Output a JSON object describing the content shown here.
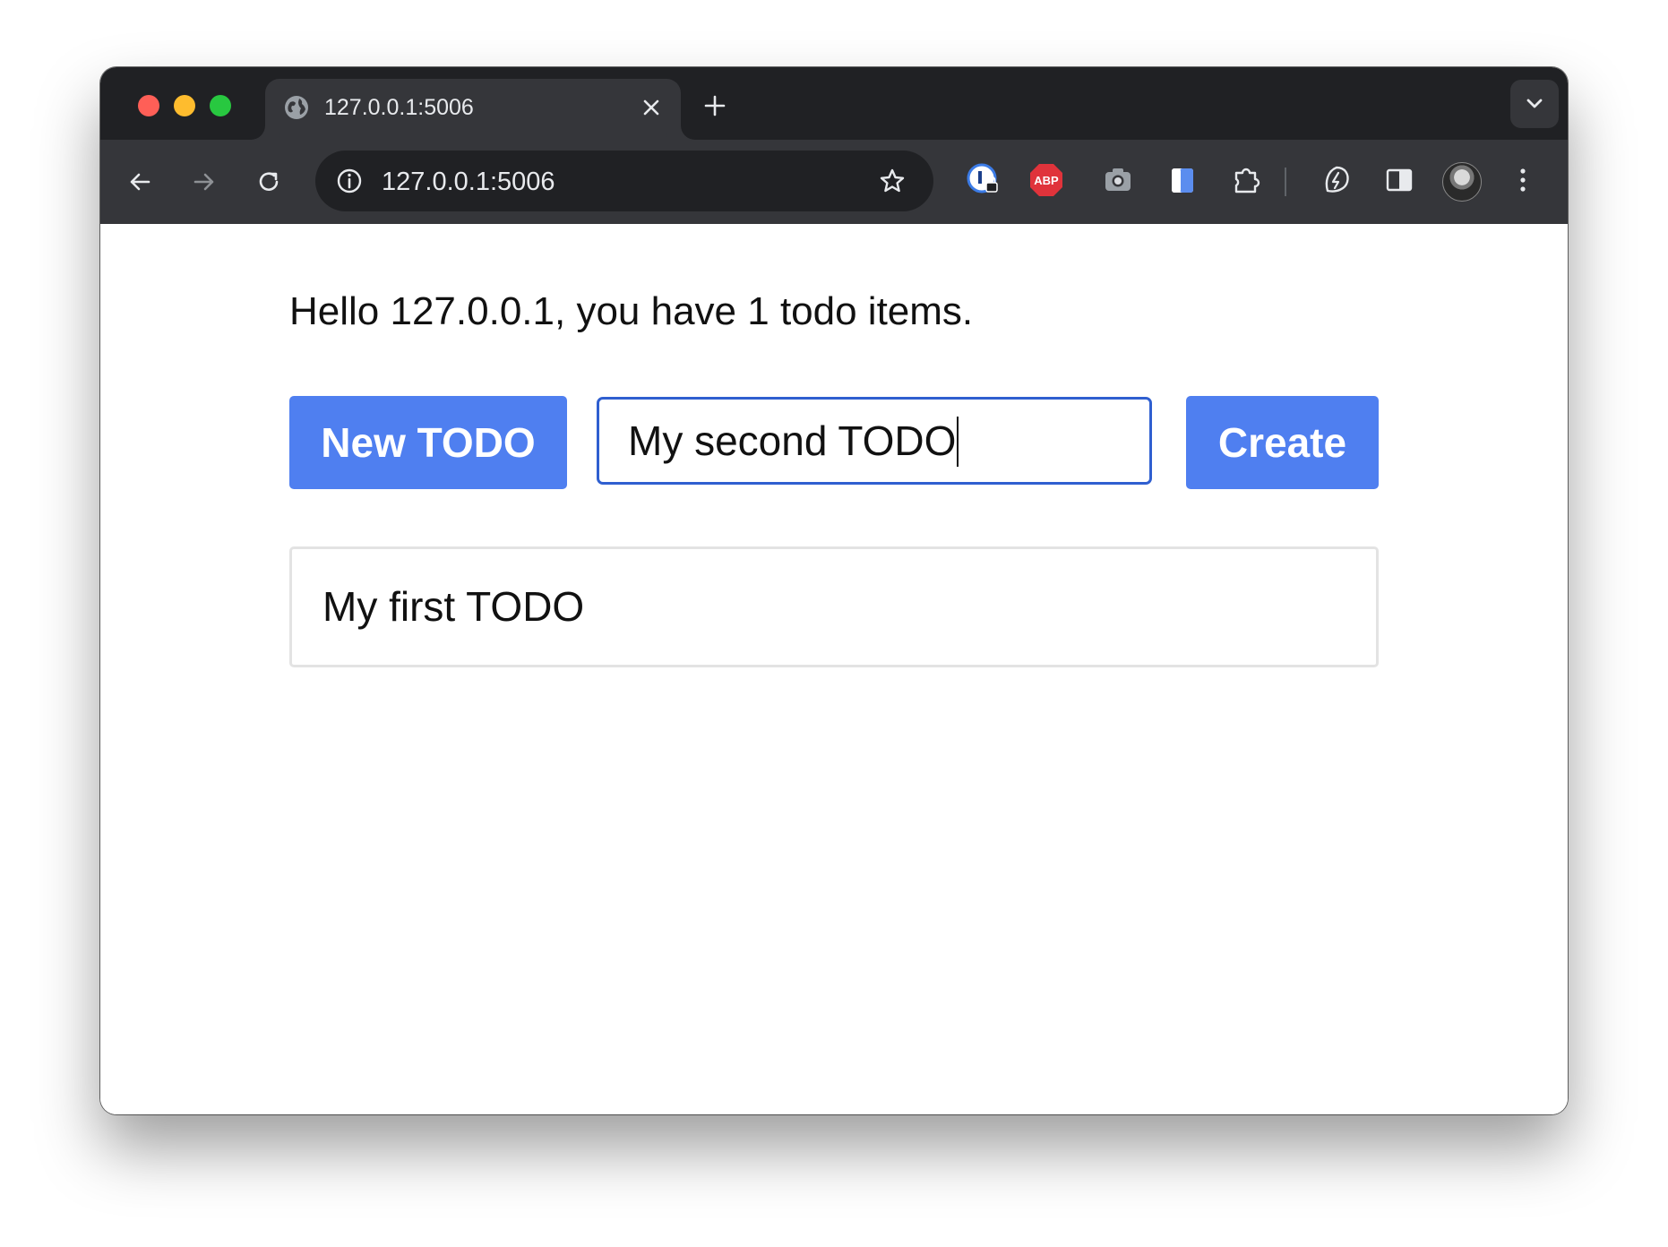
{
  "browser": {
    "tab": {
      "title": "127.0.0.1:5006",
      "favicon": "globe-icon",
      "close_icon": "close-icon"
    },
    "new_tab_icon": "plus-icon",
    "tab_search_icon": "chevron-down-icon",
    "address_bar": {
      "url": "127.0.0.1:5006",
      "site_info_icon": "info-icon",
      "bookmark_icon": "star-icon"
    },
    "nav": {
      "back_icon": "arrow-left-icon",
      "forward_icon": "arrow-right-icon",
      "reload_icon": "reload-icon"
    },
    "extensions": [
      {
        "name": "password-manager-extension-icon"
      },
      {
        "name": "adblock-plus-extension-icon",
        "label": "ABP"
      },
      {
        "name": "camera-extension-icon"
      },
      {
        "name": "clipboard-extension-icon"
      },
      {
        "name": "puzzle-extensions-icon"
      },
      {
        "name": "performance-leaf-icon"
      },
      {
        "name": "side-panel-icon"
      },
      {
        "name": "profile-avatar"
      },
      {
        "name": "more-menu-icon"
      }
    ],
    "colors": {
      "tabstrip": "#202124",
      "toolbar": "#35363a",
      "omnibox": "#202124"
    }
  },
  "page": {
    "greeting": "Hello 127.0.0.1, you have 1 todo items.",
    "new_todo_label": "New TODO",
    "todo_input_value": "My second TODO",
    "create_label": "Create",
    "todos": [
      {
        "text": "My first TODO"
      }
    ],
    "colors": {
      "button": "#4f7ff0",
      "input_border": "#2f5fd0"
    }
  }
}
